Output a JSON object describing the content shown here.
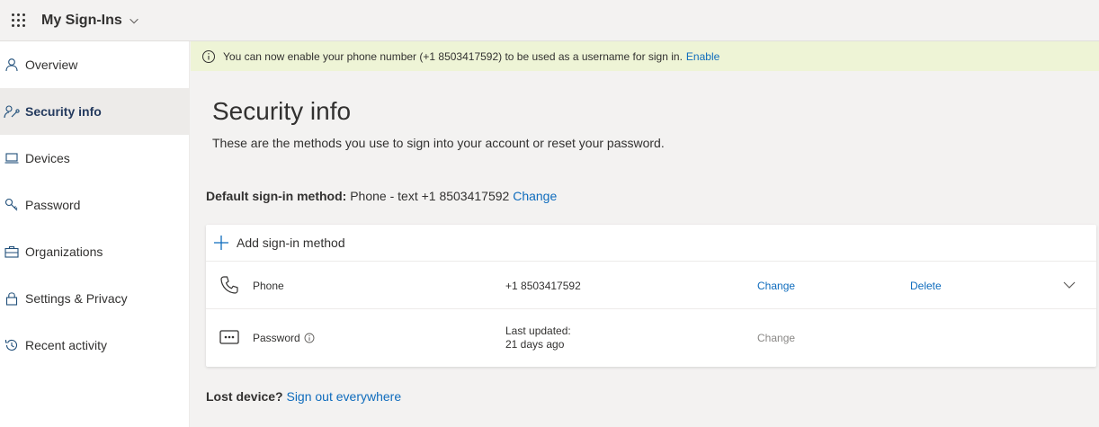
{
  "header": {
    "app_title": "My Sign-Ins",
    "waffle_icon": "waffle-icon",
    "chevron_icon": "chevron-down-icon"
  },
  "sidebar": {
    "items": [
      {
        "label": "Overview",
        "icon": "person-icon",
        "active": false
      },
      {
        "label": "Security info",
        "icon": "person-key-icon",
        "active": true
      },
      {
        "label": "Devices",
        "icon": "laptop-icon",
        "active": false
      },
      {
        "label": "Password",
        "icon": "key-icon",
        "active": false
      },
      {
        "label": "Organizations",
        "icon": "briefcase-icon",
        "active": false
      },
      {
        "label": "Settings & Privacy",
        "icon": "lock-icon",
        "active": false
      },
      {
        "label": "Recent activity",
        "icon": "history-icon",
        "active": false
      }
    ]
  },
  "banner": {
    "text": "You can now enable your phone number (+1 8503417592) to be used as a username for sign in.",
    "link": "Enable",
    "background": "#eef4d6"
  },
  "main": {
    "title": "Security info",
    "subtitle": "These are the methods you use to sign into your account or reset your password.",
    "default_label": "Default sign-in method:",
    "default_value": "Phone - text +1 8503417592",
    "default_change": "Change",
    "add_method": "Add sign-in method",
    "methods": [
      {
        "name": "Phone",
        "icon": "phone-icon",
        "detail_line1": "+1 8503417592",
        "detail_line2": "",
        "change": "Change",
        "delete": "Delete"
      },
      {
        "name": "Password",
        "icon": "password-icon",
        "detail_line1": "Last updated:",
        "detail_line2": "21 days ago",
        "change": "Change",
        "delete": ""
      }
    ],
    "lost_label": "Lost device?",
    "lost_link": "Sign out everywhere"
  },
  "colors": {
    "accent": "#0f6cbd",
    "active_nav_bg": "#edebe9",
    "page_bg": "#f3f2f1"
  }
}
